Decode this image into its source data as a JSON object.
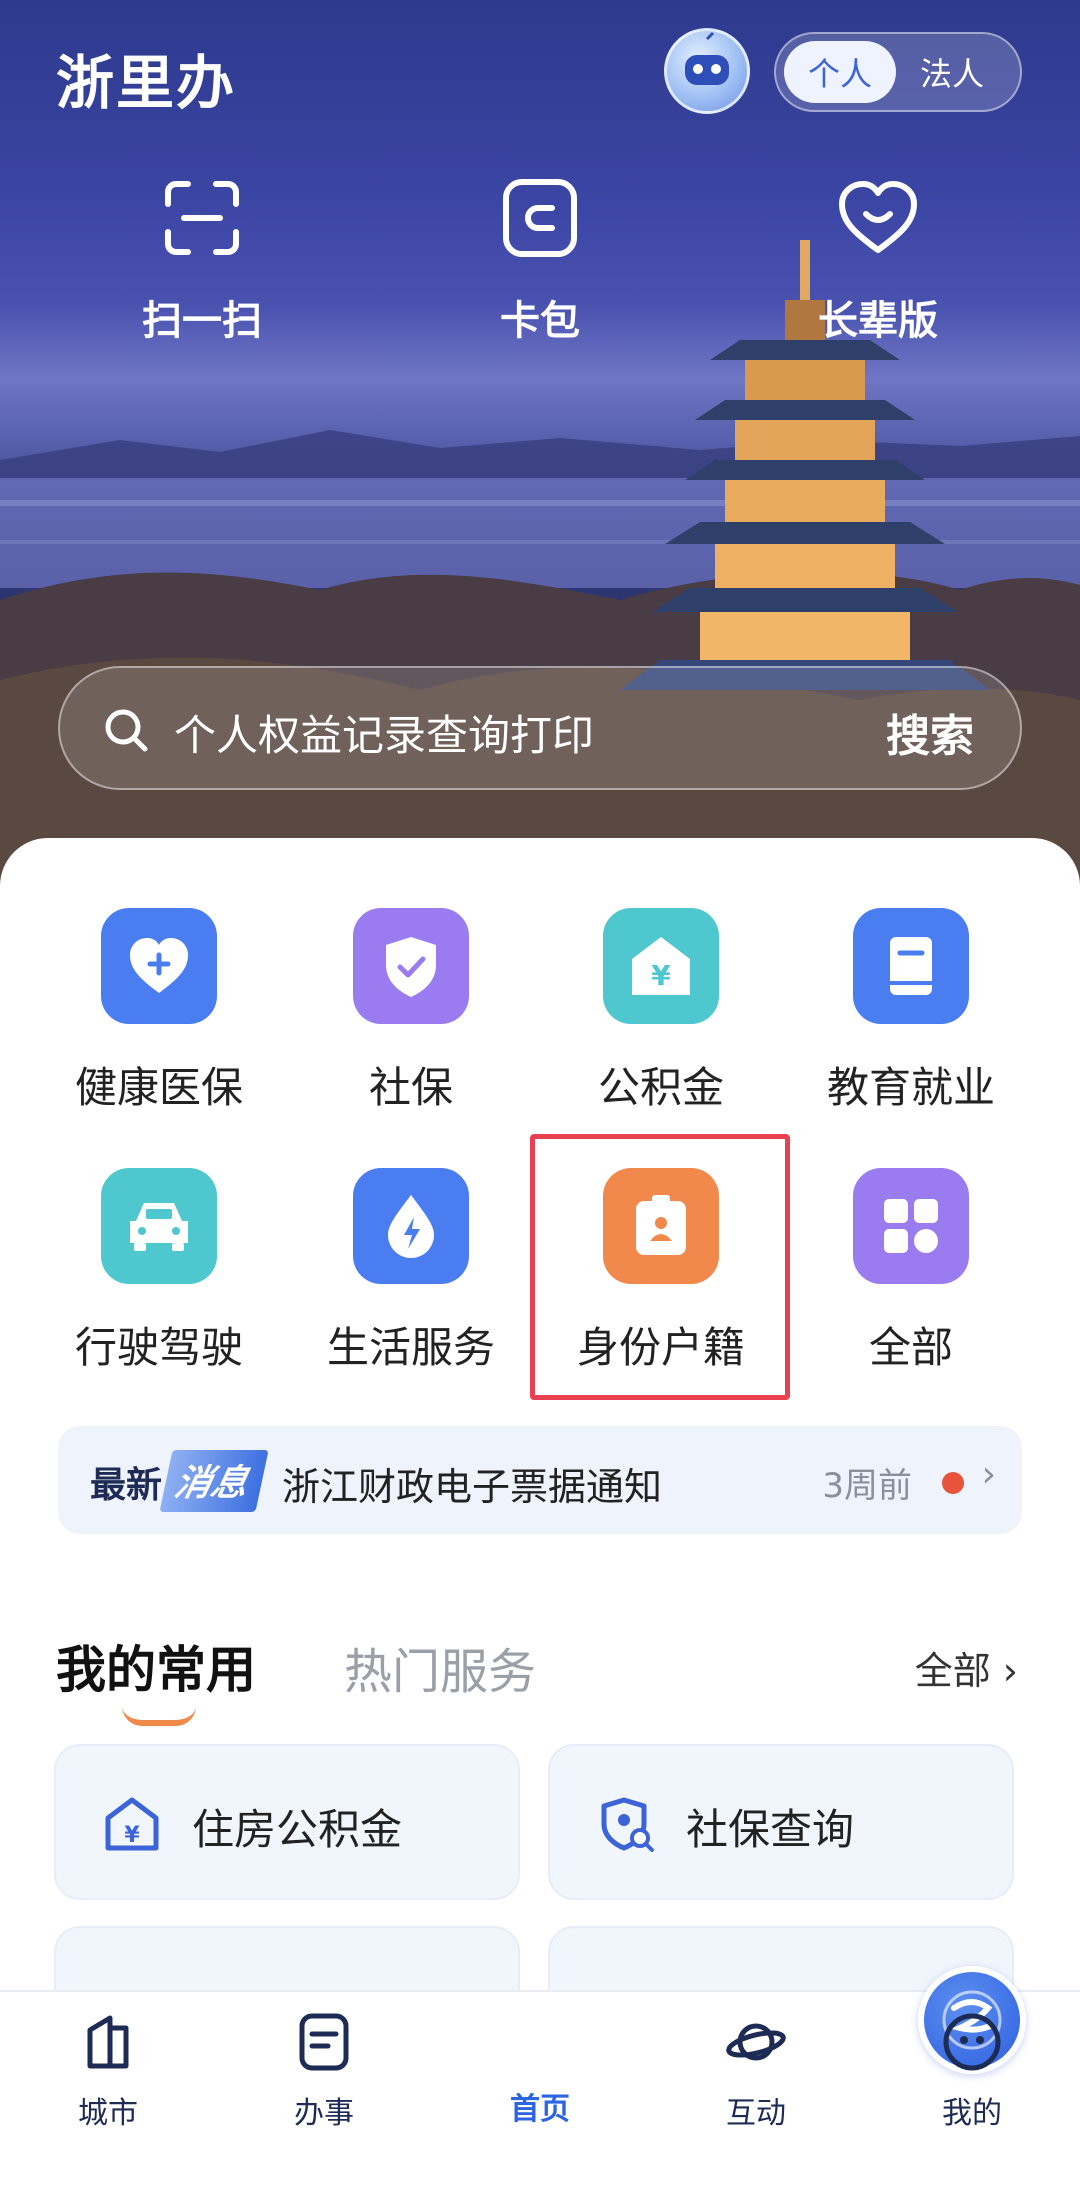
{
  "header": {
    "logo_text": "浙里办",
    "mode_toggle": {
      "selected": "个人",
      "other": "法人"
    }
  },
  "quick_actions": [
    {
      "label": "扫一扫",
      "icon": "scan-icon"
    },
    {
      "label": "卡包",
      "icon": "card-wallet-icon"
    },
    {
      "label": "长辈版",
      "icon": "heart-icon"
    }
  ],
  "search": {
    "placeholder": "个人权益记录查询打印",
    "button_label": "搜索"
  },
  "services": [
    {
      "label": "健康医保",
      "icon": "health-insurance-icon",
      "color": "#4a7ef0"
    },
    {
      "label": "社保",
      "icon": "shield-check-icon",
      "color": "#9a7cf0"
    },
    {
      "label": "公积金",
      "icon": "housing-fund-icon",
      "color": "#4fc7cf"
    },
    {
      "label": "教育就业",
      "icon": "book-icon",
      "color": "#4a7ef0"
    },
    {
      "label": "行驶驾驶",
      "icon": "car-icon",
      "color": "#4fc7cf"
    },
    {
      "label": "生活服务",
      "icon": "utility-bolt-icon",
      "color": "#4a7ef0"
    },
    {
      "label": "身份户籍",
      "icon": "id-card-icon",
      "color": "#f0894b"
    },
    {
      "label": "全部",
      "icon": "grid-icon",
      "color": "#9a7cf0"
    }
  ],
  "news": {
    "tag_main": "最新",
    "tag_accent": "消息",
    "text": "浙江财政电子票据通知",
    "time": "3周前"
  },
  "tabs": {
    "active": "我的常用",
    "inactive": "热门服务",
    "all_label": "全部 ›"
  },
  "favorites": [
    {
      "label": "住房公积金",
      "icon": "housing-fund-icon"
    },
    {
      "label": "社保查询",
      "icon": "shield-search-icon"
    }
  ],
  "bottom_nav": [
    {
      "label": "城市",
      "icon": "city-icon"
    },
    {
      "label": "办事",
      "icon": "document-icon"
    },
    {
      "label": "首页",
      "icon": "home-logo-icon",
      "active": true
    },
    {
      "label": "互动",
      "icon": "planet-icon"
    },
    {
      "label": "我的",
      "icon": "face-icon"
    }
  ],
  "colors": {
    "accent": "#2d64e0",
    "highlight_box": "#e8414f",
    "news_dot": "#e8533b",
    "tab_underline": "#f08a4b"
  }
}
